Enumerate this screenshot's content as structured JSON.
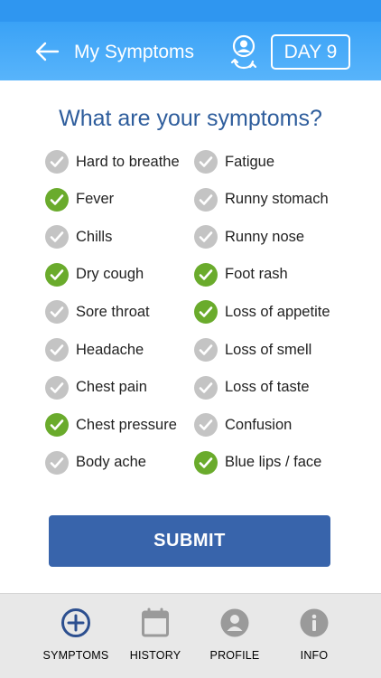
{
  "header": {
    "title": "My Symptoms",
    "day_label": "DAY 9",
    "colors": {
      "bar": "#3aa2f6",
      "status": "#2f96f0"
    }
  },
  "main": {
    "question": "What are your symptoms?",
    "symptoms": [
      {
        "label": "Hard to breathe",
        "checked": false
      },
      {
        "label": "Fatigue",
        "checked": false
      },
      {
        "label": "Fever",
        "checked": true
      },
      {
        "label": "Runny stomach",
        "checked": false
      },
      {
        "label": "Chills",
        "checked": false
      },
      {
        "label": "Runny nose",
        "checked": false
      },
      {
        "label": "Dry cough",
        "checked": true
      },
      {
        "label": "Foot rash",
        "checked": true
      },
      {
        "label": "Sore throat",
        "checked": false
      },
      {
        "label": "Loss of appetite",
        "checked": true
      },
      {
        "label": "Headache",
        "checked": false
      },
      {
        "label": "Loss of smell",
        "checked": false
      },
      {
        "label": "Chest pain",
        "checked": false
      },
      {
        "label": "Loss of taste",
        "checked": false
      },
      {
        "label": "Chest pressure",
        "checked": true
      },
      {
        "label": "Confusion",
        "checked": false
      },
      {
        "label": "Body ache",
        "checked": false
      },
      {
        "label": "Blue lips / face",
        "checked": true
      }
    ],
    "submit_label": "SUBMIT",
    "colors": {
      "checked": "#6aab2c",
      "unchecked": "#c4c4c4",
      "question": "#2e5d9c",
      "submit": "#3864ab"
    }
  },
  "tabs": [
    {
      "label": "SYMPTOMS",
      "icon": "plus-circle-icon",
      "active": true
    },
    {
      "label": "HISTORY",
      "icon": "calendar-icon",
      "active": false
    },
    {
      "label": "PROFILE",
      "icon": "person-icon",
      "active": false
    },
    {
      "label": "INFO",
      "icon": "info-icon",
      "active": false
    }
  ]
}
